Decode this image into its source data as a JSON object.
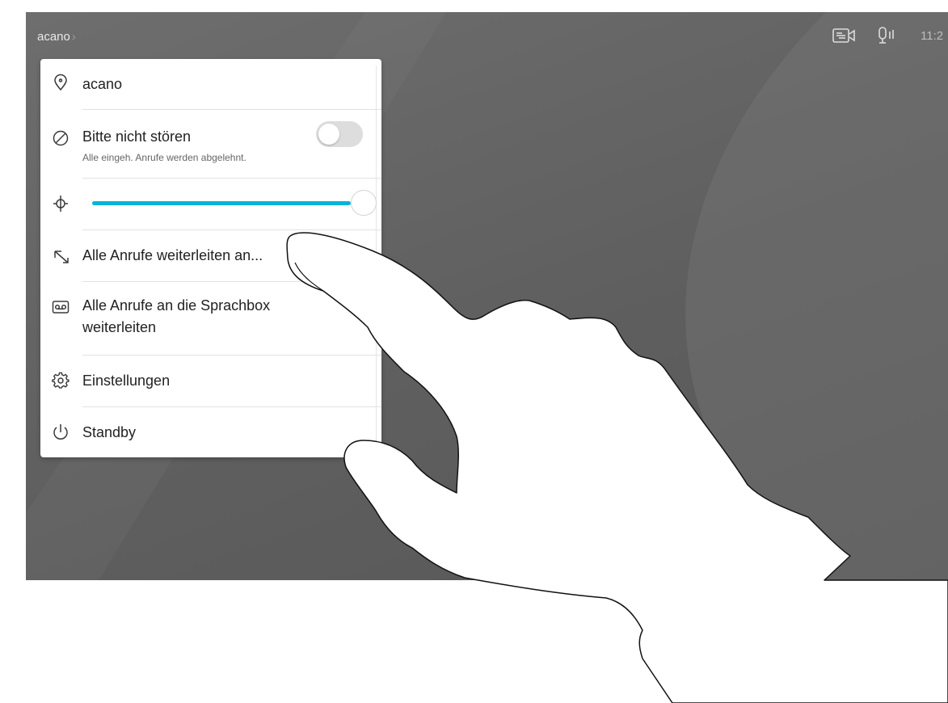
{
  "topbar": {
    "title": "acano",
    "breadcrumb_chevron": "›",
    "icons": [
      "camera-settings-icon",
      "microphone-icon"
    ],
    "clock": "11:2"
  },
  "menu": {
    "location": {
      "label": "acano",
      "icon": "location-pin-icon"
    },
    "do_not_disturb": {
      "label": "Bitte nicht stören",
      "sublabel": "Alle eingeh. Anrufe werden abgelehnt.",
      "icon": "block-icon",
      "enabled": false
    },
    "brightness": {
      "icon": "brightness-icon",
      "level": 1.0
    },
    "forward_all": {
      "label": "Alle Anrufe weiterleiten an...",
      "icon": "forward-arrow-icon"
    },
    "voicemail": {
      "label_line1": "Alle Anrufe an die Sprachbox",
      "label_line2": "weiterleiten",
      "icon": "voicemail-icon"
    },
    "settings": {
      "label": "Einstellungen",
      "icon": "gear-icon"
    },
    "standby": {
      "label": "Standby",
      "icon": "power-icon"
    }
  },
  "colors": {
    "accent": "#06b4d8",
    "screen_background": "#656565",
    "panel": "#ffffff"
  }
}
